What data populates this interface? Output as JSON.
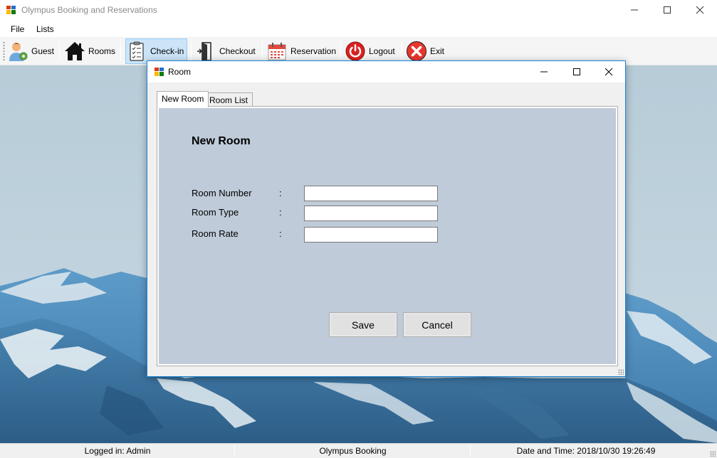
{
  "app": {
    "title": "Olympus Booking and Reservations"
  },
  "menu": {
    "file": "File",
    "lists": "Lists"
  },
  "toolbar": {
    "guest": "Guest",
    "rooms": "Rooms",
    "checkin": "Check-in",
    "checkout": "Checkout",
    "reservation": "Reservation",
    "logout": "Logout",
    "exit": "Exit",
    "icons": [
      "guest-icon",
      "house-icon",
      "clipboard-icon",
      "door-exit-icon",
      "calendar-icon",
      "power-icon",
      "close-circle-icon"
    ]
  },
  "dialog": {
    "title": "Room",
    "tabs": [
      "New Room",
      "Room List"
    ],
    "active_tab": "New Room",
    "form": {
      "heading": "New Room",
      "fields": [
        {
          "label": "Room Number",
          "colon": ":",
          "value": ""
        },
        {
          "label": "Room Type",
          "colon": ":",
          "value": ""
        },
        {
          "label": "Room Rate",
          "colon": ":",
          "value": ""
        }
      ],
      "save": "Save",
      "cancel": "Cancel"
    }
  },
  "status": {
    "logged_in": "Logged in: Admin",
    "app_name": "Olympus Booking",
    "datetime": "Date and Time: 2018/10/30 19:26:49"
  },
  "colors": {
    "accent_border": "#1883d7",
    "panel_bg": "#bfcbd9",
    "active_tool_bg": "#cce4f7"
  }
}
